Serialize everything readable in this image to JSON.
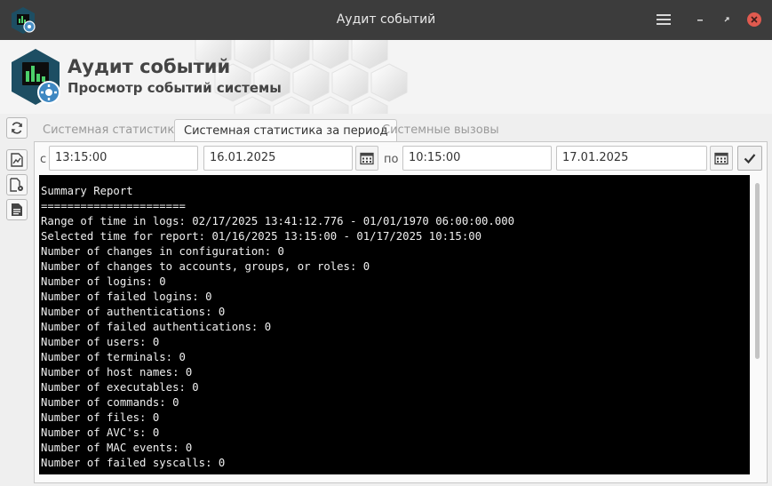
{
  "window": {
    "title": "Аудит событий"
  },
  "header": {
    "title": "Аудит событий",
    "subtitle": "Просмотр событий системы"
  },
  "tabs": [
    {
      "label": "Системная статистика",
      "active": false
    },
    {
      "label": "Системная статистика за период",
      "active": true
    },
    {
      "label": "Системные вызовы",
      "active": false
    }
  ],
  "filter": {
    "from_label": "с",
    "from_time": "13:15:00",
    "from_date": "16.01.2025",
    "to_label": "по",
    "to_time": "10:15:00",
    "to_date": "17.01.2025"
  },
  "report_lines": [
    "Summary Report",
    "======================",
    "Range of time in logs: 02/17/2025 13:41:12.776 - 01/01/1970 06:00:00.000",
    "Selected time for report: 01/16/2025 13:15:00 - 01/17/2025 10:15:00",
    "Number of changes in configuration: 0",
    "Number of changes to accounts, groups, or roles: 0",
    "Number of logins: 0",
    "Number of failed logins: 0",
    "Number of authentications: 0",
    "Number of failed authentications: 0",
    "Number of users: 0",
    "Number of terminals: 0",
    "Number of host names: 0",
    "Number of executables: 0",
    "Number of commands: 0",
    "Number of files: 0",
    "Number of AVC's: 0",
    "Number of MAC events: 0",
    "Number of failed syscalls: 0"
  ],
  "colors": {
    "titlebar": "#3c3c3c",
    "close_button": "#e05a4f",
    "terminal_bg": "#000000",
    "terminal_fg": "#f0f0f0",
    "logo_teal": "#1d4e63"
  },
  "icons": {
    "app": "audit-app-icon",
    "menu": "hamburger-icon",
    "minimize": "minimize-icon",
    "maximize": "maximize-icon",
    "close": "close-icon",
    "refresh": "refresh-icon",
    "report": "report-document-icon",
    "settings_doc": "document-gear-icon",
    "text_doc": "text-document-icon",
    "calendar": "calendar-icon",
    "apply": "checkmark-icon"
  }
}
